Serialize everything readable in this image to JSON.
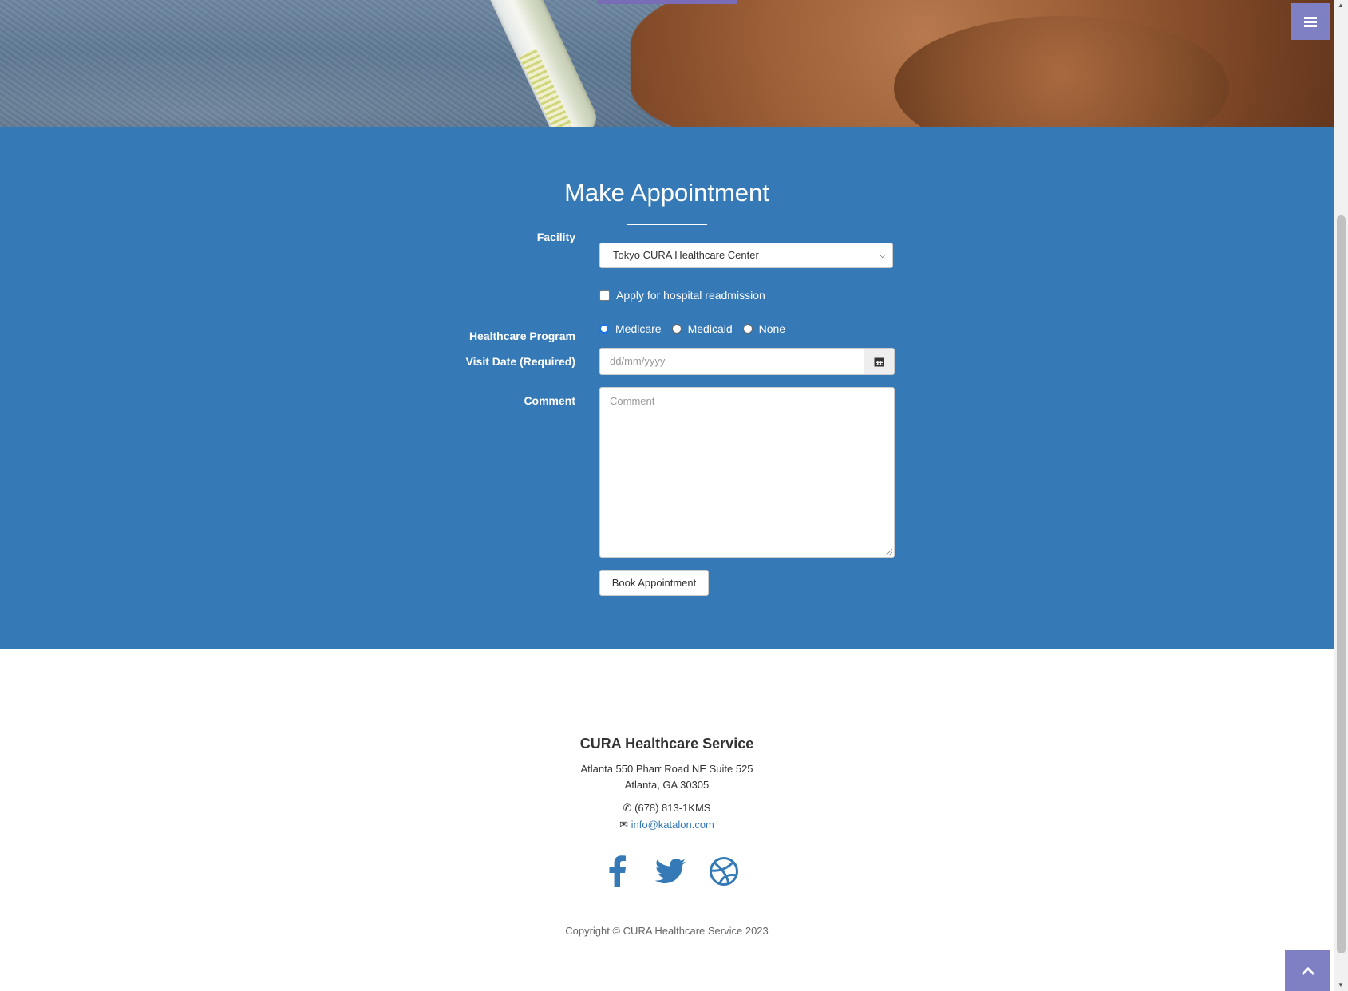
{
  "header": {
    "menu_icon": "bars-icon"
  },
  "appointment": {
    "title": "Make Appointment",
    "facility_label": "Facility",
    "facility_selected": "Tokyo CURA Healthcare Center",
    "readmission_label": "Apply for hospital readmission",
    "program_label": "Healthcare Program",
    "program_options": [
      "Medicare",
      "Medicaid",
      "None"
    ],
    "program_selected": "Medicare",
    "visit_date_label": "Visit Date (Required)",
    "visit_date_placeholder": "dd/mm/yyyy",
    "comment_label": "Comment",
    "comment_placeholder": "Comment",
    "book_button": "Book Appointment",
    "accent_color": "#3579b6"
  },
  "footer": {
    "brand": "CURA Healthcare Service",
    "address_line1": "Atlanta 550 Pharr Road NE Suite 525",
    "address_line2": "Atlanta, GA 30305",
    "phone": "(678) 813-1KMS",
    "email": "info@katalon.com",
    "social": [
      "facebook-icon",
      "twitter-icon",
      "dribbble-icon"
    ],
    "copyright": "Copyright © CURA Healthcare Service 2023"
  }
}
